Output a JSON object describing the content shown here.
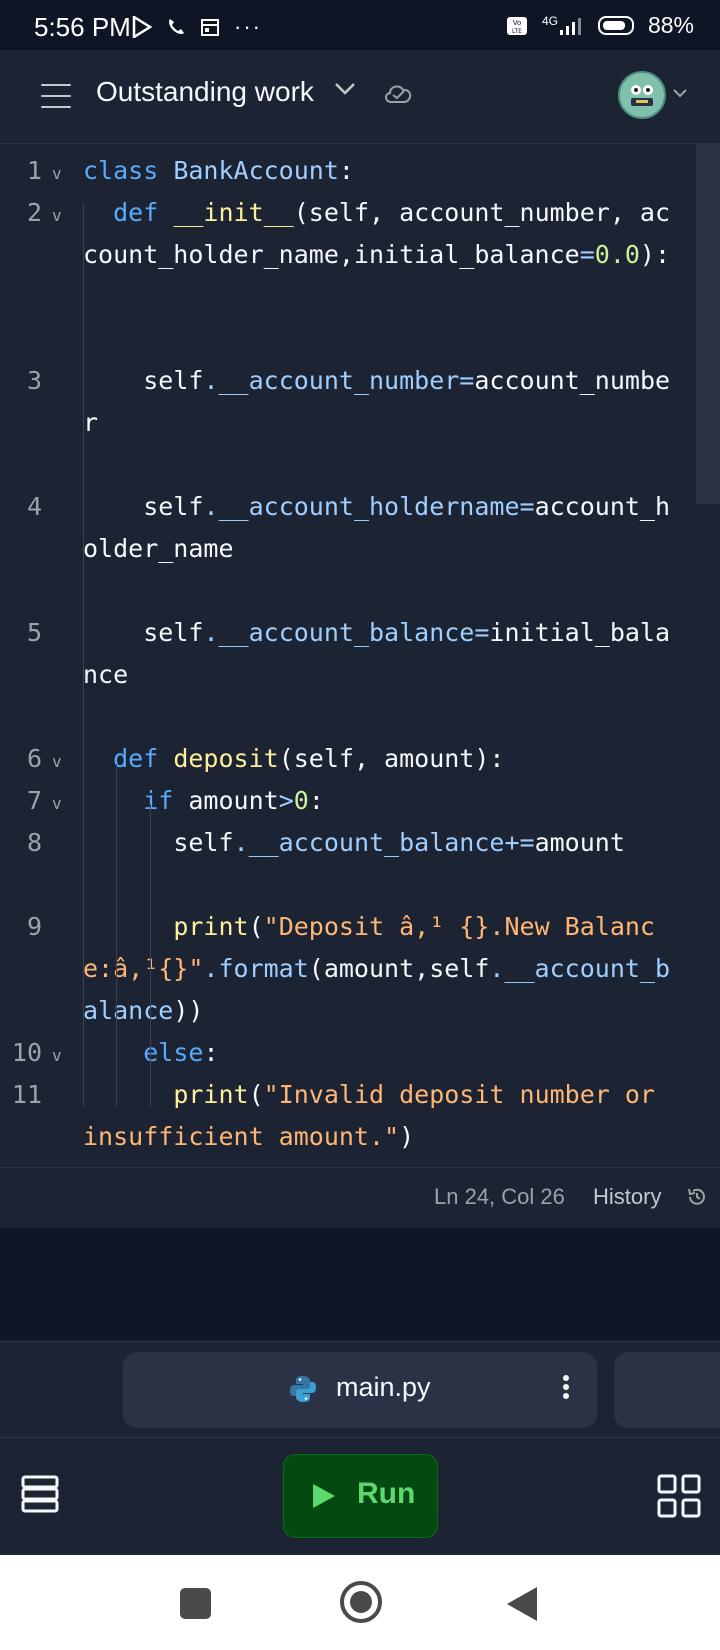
{
  "status_bar": {
    "time": "5:56 PM",
    "network": "4G",
    "battery": "88%"
  },
  "header": {
    "title": "Outstanding work"
  },
  "editor": {
    "lines": [
      {
        "num": "1",
        "fold": "v",
        "tokens": [
          [
            "kw",
            "class "
          ],
          [
            "attr",
            "BankAccount"
          ],
          [
            "id",
            ":"
          ]
        ]
      },
      {
        "num": "2",
        "fold": "v",
        "tokens": [
          [
            "kw",
            "  def "
          ],
          [
            "fn",
            "__init__"
          ],
          [
            "id",
            "(self, account_number, account_holder_name,initial_balance"
          ],
          [
            "attr",
            "="
          ],
          [
            "num-lit",
            "0.0"
          ],
          [
            "id",
            "):"
          ]
        ]
      },
      {
        "num": "3",
        "fold": "",
        "tokens": [
          [
            "id",
            "    self"
          ],
          [
            "attr",
            ".__account_number="
          ],
          [
            "id",
            "account_number"
          ]
        ]
      },
      {
        "num": "4",
        "fold": "",
        "tokens": [
          [
            "id",
            "    self"
          ],
          [
            "attr",
            ".__account_holdername="
          ],
          [
            "id",
            "account_holder_name"
          ]
        ]
      },
      {
        "num": "5",
        "fold": "",
        "tokens": [
          [
            "id",
            "    self"
          ],
          [
            "attr",
            ".__account_balance="
          ],
          [
            "id",
            "initial_balance"
          ]
        ]
      },
      {
        "num": "6",
        "fold": "v",
        "tokens": [
          [
            "kw",
            "  def "
          ],
          [
            "fn",
            "deposit"
          ],
          [
            "id",
            "(self, amount):"
          ]
        ]
      },
      {
        "num": "7",
        "fold": "v",
        "tokens": [
          [
            "kw",
            "    if "
          ],
          [
            "id",
            "amount"
          ],
          [
            "attr",
            ">"
          ],
          [
            "num-lit",
            "0"
          ],
          [
            "id",
            ":"
          ]
        ]
      },
      {
        "num": "8",
        "fold": "",
        "tokens": [
          [
            "id",
            "      self"
          ],
          [
            "attr",
            ".__account_balance+="
          ],
          [
            "id",
            "amount"
          ]
        ]
      },
      {
        "num": "9",
        "fold": "",
        "tokens": [
          [
            "fn",
            "      print"
          ],
          [
            "id",
            "("
          ],
          [
            "str",
            "\"Deposit â,¹ {}.New Balance:â,¹{}\""
          ],
          [
            "attr",
            ".format"
          ],
          [
            "id",
            "(amount,self"
          ],
          [
            "attr",
            ".__account_balance"
          ],
          [
            "id",
            "))"
          ]
        ]
      },
      {
        "num": "10",
        "fold": "v",
        "tokens": [
          [
            "kw",
            "    else"
          ],
          [
            "id",
            ":"
          ]
        ]
      },
      {
        "num": "11",
        "fold": "",
        "tokens": [
          [
            "fn",
            "      print"
          ],
          [
            "id",
            "("
          ],
          [
            "str",
            "\"Invalid deposit number or insufficient amount.\""
          ],
          [
            "id",
            ")"
          ]
        ]
      }
    ]
  },
  "editor_status": {
    "cursor": "Ln 24, Col 26",
    "history": "History"
  },
  "tab": {
    "filename": "main.py"
  },
  "toolbar": {
    "run_label": "Run"
  },
  "colors": {
    "background": "#1c2333",
    "run_green": "#5bd96f"
  }
}
